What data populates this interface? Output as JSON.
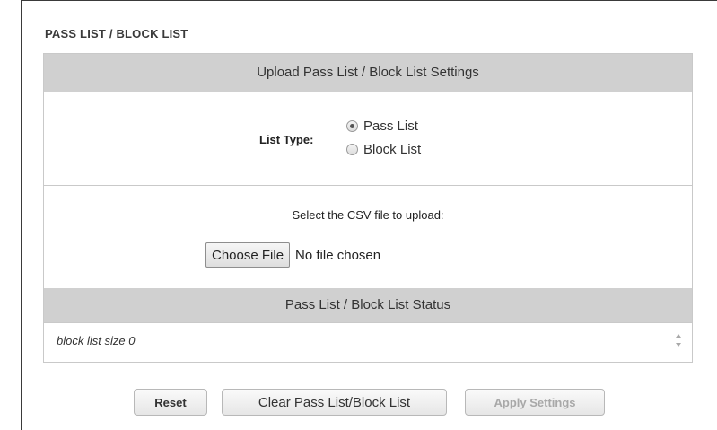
{
  "section": {
    "title": "PASS LIST / BLOCK LIST"
  },
  "upload_panel": {
    "header": "Upload Pass List / Block List Settings",
    "list_type_label": "List Type:",
    "options": [
      {
        "label": "Pass List",
        "selected": true
      },
      {
        "label": "Block List",
        "selected": false
      }
    ],
    "select_text": "Select the CSV file to upload:",
    "choose_file_label": "Choose File",
    "file_status": "No file chosen"
  },
  "status_panel": {
    "header": "Pass List / Block List Status",
    "text": "block list size 0"
  },
  "buttons": {
    "reset": "Reset",
    "clear": "Clear Pass List/Block List",
    "apply": "Apply Settings"
  },
  "colors": {
    "panel_header_bg": "#d0d0d0",
    "disabled_text": "#a8a8a8"
  }
}
